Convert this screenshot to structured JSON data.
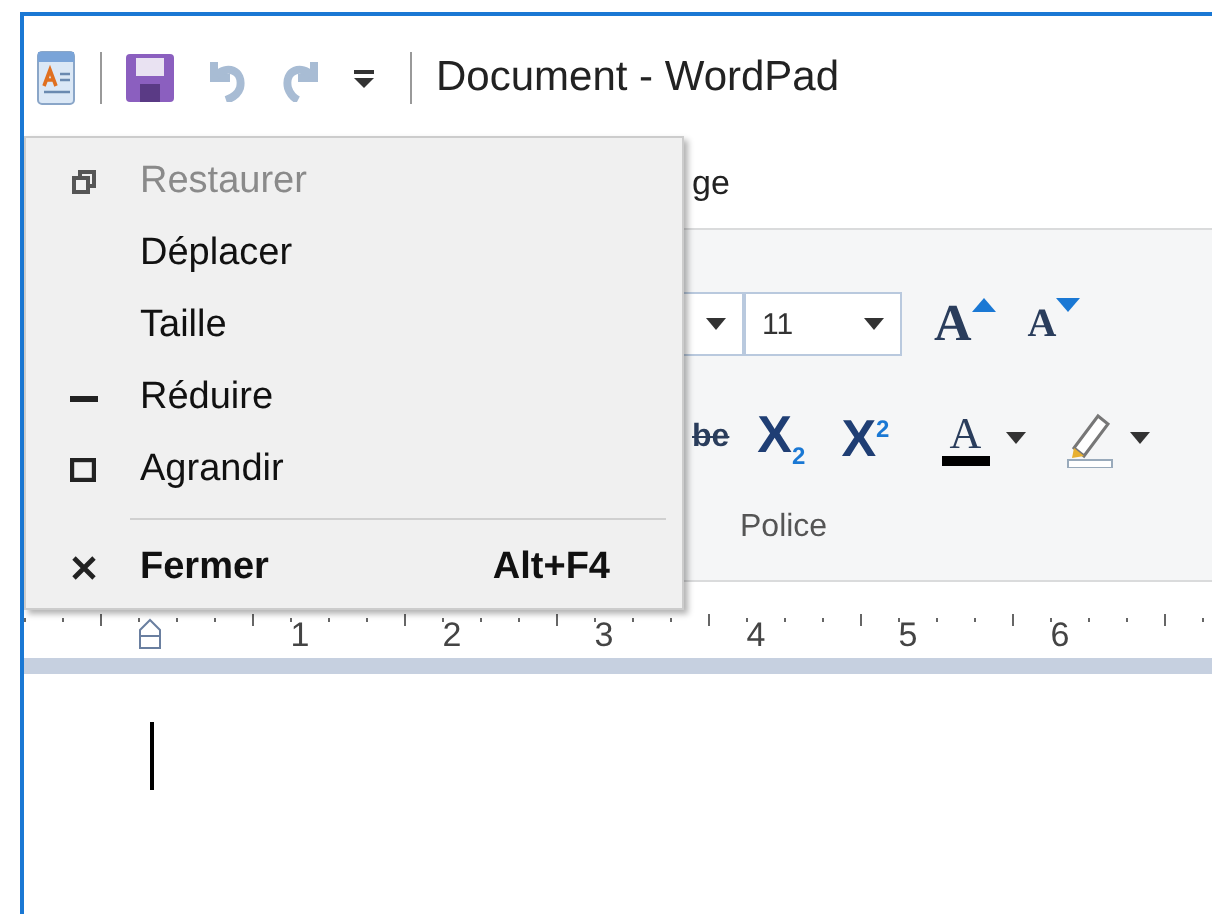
{
  "window": {
    "title": "Document - WordPad"
  },
  "ribbon": {
    "tab_fragment": "ge",
    "font_size": "11",
    "buttons": [
      {
        "kind": "grow",
        "label": "A"
      },
      {
        "kind": "shrink",
        "label": "A"
      },
      {
        "kind": "strike",
        "label": "be"
      },
      {
        "kind": "sub",
        "label": "X$_{2}$"
      },
      {
        "kind": "sup",
        "label": "X$^{2}$"
      },
      {
        "kind": "color",
        "label": "A"
      },
      {
        "kind": "highlight"
      }
    ],
    "group_label": "Police"
  },
  "ruler": {
    "numbers": [
      "1",
      "2",
      "3",
      "4",
      "5",
      "6"
    ]
  },
  "system_menu": {
    "items": [
      {
        "kind": "restore",
        "label": "Restaurer",
        "disabled": true,
        "default": false
      },
      {
        "kind": "plain",
        "label": "Déplacer",
        "disabled": false,
        "default": false
      },
      {
        "kind": "plain",
        "label": "Taille",
        "disabled": false,
        "default": false
      },
      {
        "kind": "minimize",
        "label": "Réduire",
        "disabled": false,
        "default": false
      },
      {
        "kind": "maximize",
        "label": "Agrandir",
        "disabled": false,
        "default": false
      },
      {
        "kind": "separator"
      },
      {
        "kind": "close",
        "label": "Fermer",
        "shortcut": "Alt+F4",
        "disabled": false,
        "default": true
      }
    ]
  }
}
